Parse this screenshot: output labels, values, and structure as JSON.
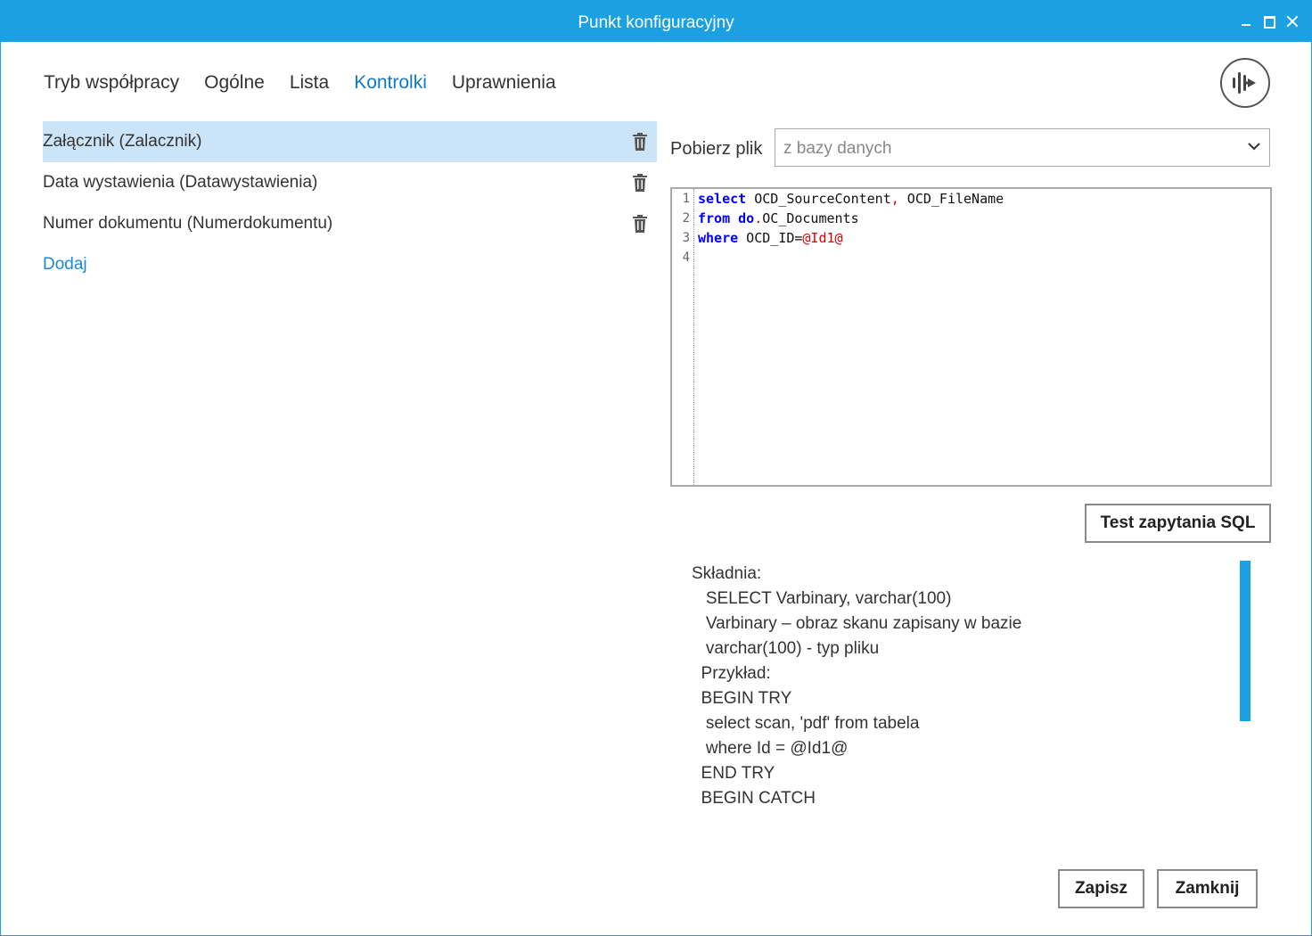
{
  "window": {
    "title": "Punkt konfiguracyjny",
    "colors": {
      "accent": "#1ba1e2",
      "selected_row": "#cce4f7",
      "active_tab": "#0f7ac8",
      "link": "#1a8ad4"
    }
  },
  "tabs": [
    {
      "label": "Tryb współpracy"
    },
    {
      "label": "Ogólne"
    },
    {
      "label": "Lista"
    },
    {
      "label": "Kontrolki",
      "active": true
    },
    {
      "label": "Uprawnienia"
    }
  ],
  "controls": {
    "items": [
      {
        "label": "Załącznik (Zalacznik)",
        "selected": true,
        "icon": "trash-icon"
      },
      {
        "label": "Data wystawienia (Datawystawienia)",
        "icon": "trash-icon"
      },
      {
        "label": "Numer dokumentu (Numerdokumentu)",
        "icon": "trash-icon"
      }
    ],
    "add_label": "Dodaj"
  },
  "source": {
    "label": "Pobierz plik",
    "selected": "z bazy danych"
  },
  "editor": {
    "line_numbers": [
      "1",
      "2",
      "3",
      "4"
    ],
    "lines": [
      {
        "kw": "select",
        "t1": " OCD_SourceContent",
        "p1": ",",
        "t2": " OCD_FileName"
      },
      {
        "kw": "from",
        "kw2": " do",
        "p1": ".",
        "t2": "OC_Documents"
      },
      {
        "kw": "where",
        "t1": " OCD_ID=",
        "param": "@Id1@"
      },
      {
        "kw": ""
      }
    ]
  },
  "buttons": {
    "test_sql": "Test zapytania SQL",
    "save": "Zapisz",
    "close": "Zamknij"
  },
  "help_text": [
    "Składnia:",
    "   SELECT Varbinary, varchar(100)",
    "   Varbinary – obraz skanu zapisany w bazie",
    "   varchar(100) - typ pliku",
    "  Przykład:",
    "  BEGIN TRY",
    "   select scan, 'pdf' from tabela",
    "   where Id = @Id1@",
    "  END TRY",
    "  BEGIN CATCH"
  ]
}
